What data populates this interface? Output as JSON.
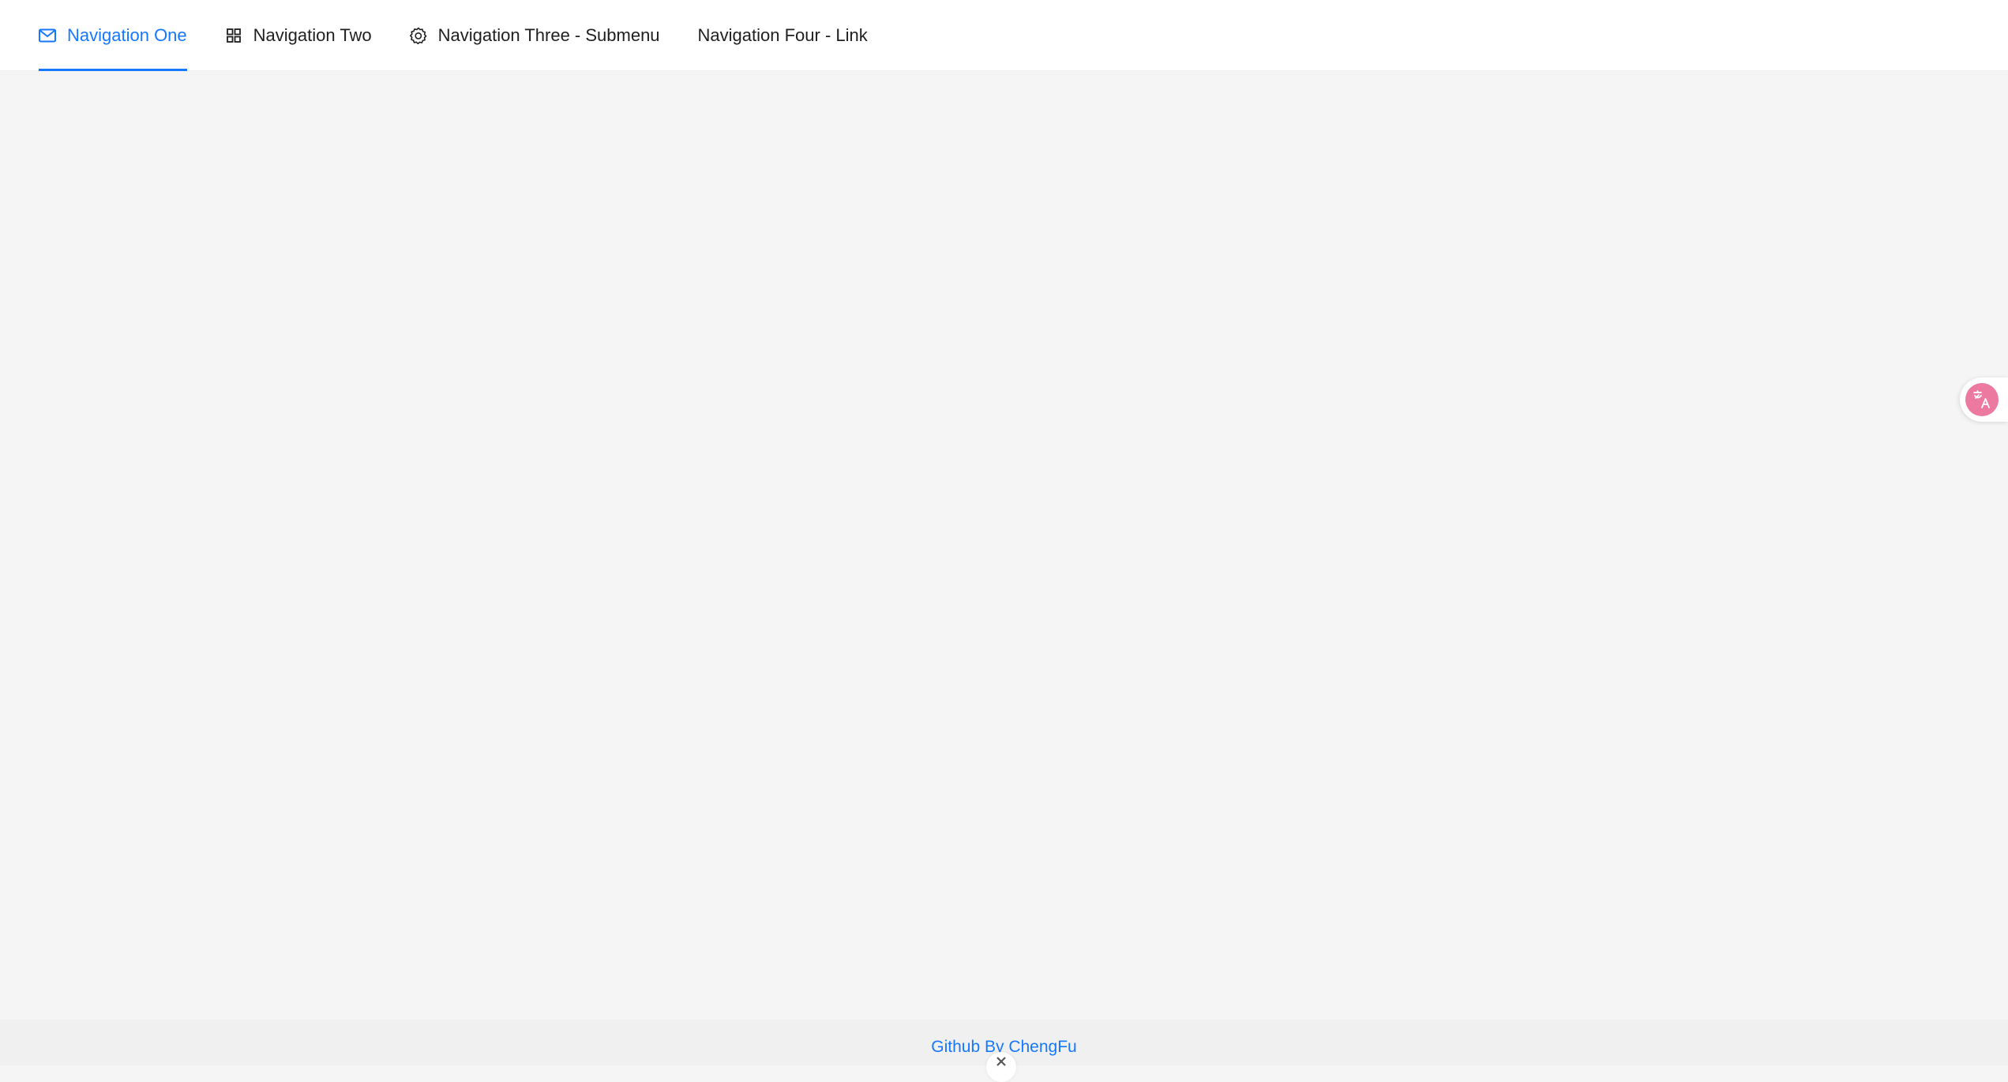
{
  "menu": {
    "items": [
      {
        "label": "Navigation One",
        "icon": "mail-icon",
        "active": true
      },
      {
        "label": "Navigation Two",
        "icon": "appstore-icon",
        "active": false
      },
      {
        "label": "Navigation Three - Submenu",
        "icon": "setting-icon",
        "active": false
      },
      {
        "label": "Navigation Four - Link",
        "icon": "",
        "active": false
      }
    ]
  },
  "footer": {
    "link_text": "Github By ChengFu"
  },
  "colors": {
    "accent": "#1677ff",
    "background": "#f5f5f5",
    "header": "#ffffff",
    "translate_badge": "#ec7aa0"
  },
  "translate_widget": {
    "icon": "translate-icon"
  }
}
